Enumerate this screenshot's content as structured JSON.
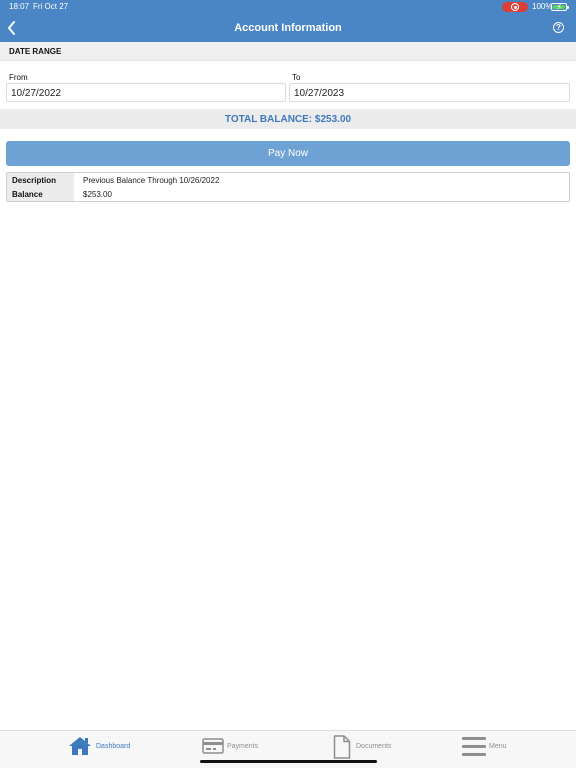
{
  "status_bar": {
    "time": "18:07",
    "date": "Fri Oct 27",
    "battery": "100%"
  },
  "nav": {
    "title": "Account Information",
    "back_icon": "chevron-left-icon",
    "help_icon": "question-circle-icon"
  },
  "date_range": {
    "header": "DATE RANGE",
    "from_label": "From",
    "from_value": "10/27/2022",
    "to_label": "To",
    "to_value": "10/27/2023"
  },
  "total_balance": "TOTAL BALANCE: $253.00",
  "pay_button_label": "Pay Now",
  "details": [
    {
      "label": "Description",
      "value": "Previous Balance Through 10/26/2022"
    },
    {
      "label": "Balance",
      "value": "$253.00"
    }
  ],
  "tabs": [
    {
      "label": "Dashboard",
      "icon": "home-icon",
      "active": true
    },
    {
      "label": "Payments",
      "icon": "credit-card-icon",
      "active": false
    },
    {
      "label": "Documents",
      "icon": "document-icon",
      "active": false
    },
    {
      "label": "Menu",
      "icon": "menu-icon",
      "active": false
    }
  ],
  "colors": {
    "primary": "#4a86c5",
    "accent_text": "#3f79bd",
    "button": "#6ea2d5",
    "recording": "#d9403a",
    "battery": "#59d35a"
  }
}
